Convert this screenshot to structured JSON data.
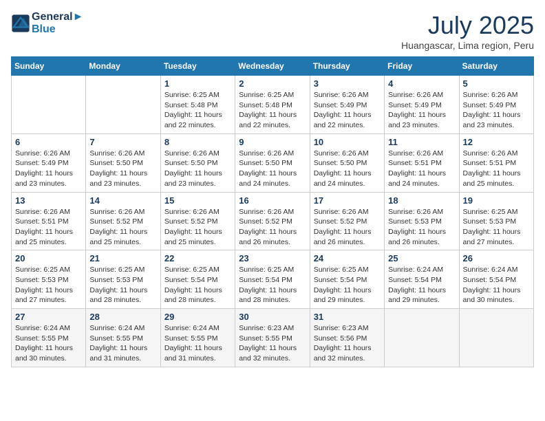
{
  "header": {
    "logo_line1": "General",
    "logo_line2": "Blue",
    "month_title": "July 2025",
    "location": "Huangascar, Lima region, Peru"
  },
  "weekdays": [
    "Sunday",
    "Monday",
    "Tuesday",
    "Wednesday",
    "Thursday",
    "Friday",
    "Saturday"
  ],
  "weeks": [
    [
      {
        "day": "",
        "info": ""
      },
      {
        "day": "",
        "info": ""
      },
      {
        "day": "1",
        "info": "Sunrise: 6:25 AM\nSunset: 5:48 PM\nDaylight: 11 hours and 22 minutes."
      },
      {
        "day": "2",
        "info": "Sunrise: 6:25 AM\nSunset: 5:48 PM\nDaylight: 11 hours and 22 minutes."
      },
      {
        "day": "3",
        "info": "Sunrise: 6:26 AM\nSunset: 5:49 PM\nDaylight: 11 hours and 22 minutes."
      },
      {
        "day": "4",
        "info": "Sunrise: 6:26 AM\nSunset: 5:49 PM\nDaylight: 11 hours and 23 minutes."
      },
      {
        "day": "5",
        "info": "Sunrise: 6:26 AM\nSunset: 5:49 PM\nDaylight: 11 hours and 23 minutes."
      }
    ],
    [
      {
        "day": "6",
        "info": "Sunrise: 6:26 AM\nSunset: 5:49 PM\nDaylight: 11 hours and 23 minutes."
      },
      {
        "day": "7",
        "info": "Sunrise: 6:26 AM\nSunset: 5:50 PM\nDaylight: 11 hours and 23 minutes."
      },
      {
        "day": "8",
        "info": "Sunrise: 6:26 AM\nSunset: 5:50 PM\nDaylight: 11 hours and 23 minutes."
      },
      {
        "day": "9",
        "info": "Sunrise: 6:26 AM\nSunset: 5:50 PM\nDaylight: 11 hours and 24 minutes."
      },
      {
        "day": "10",
        "info": "Sunrise: 6:26 AM\nSunset: 5:50 PM\nDaylight: 11 hours and 24 minutes."
      },
      {
        "day": "11",
        "info": "Sunrise: 6:26 AM\nSunset: 5:51 PM\nDaylight: 11 hours and 24 minutes."
      },
      {
        "day": "12",
        "info": "Sunrise: 6:26 AM\nSunset: 5:51 PM\nDaylight: 11 hours and 25 minutes."
      }
    ],
    [
      {
        "day": "13",
        "info": "Sunrise: 6:26 AM\nSunset: 5:51 PM\nDaylight: 11 hours and 25 minutes."
      },
      {
        "day": "14",
        "info": "Sunrise: 6:26 AM\nSunset: 5:52 PM\nDaylight: 11 hours and 25 minutes."
      },
      {
        "day": "15",
        "info": "Sunrise: 6:26 AM\nSunset: 5:52 PM\nDaylight: 11 hours and 25 minutes."
      },
      {
        "day": "16",
        "info": "Sunrise: 6:26 AM\nSunset: 5:52 PM\nDaylight: 11 hours and 26 minutes."
      },
      {
        "day": "17",
        "info": "Sunrise: 6:26 AM\nSunset: 5:52 PM\nDaylight: 11 hours and 26 minutes."
      },
      {
        "day": "18",
        "info": "Sunrise: 6:26 AM\nSunset: 5:53 PM\nDaylight: 11 hours and 26 minutes."
      },
      {
        "day": "19",
        "info": "Sunrise: 6:25 AM\nSunset: 5:53 PM\nDaylight: 11 hours and 27 minutes."
      }
    ],
    [
      {
        "day": "20",
        "info": "Sunrise: 6:25 AM\nSunset: 5:53 PM\nDaylight: 11 hours and 27 minutes."
      },
      {
        "day": "21",
        "info": "Sunrise: 6:25 AM\nSunset: 5:53 PM\nDaylight: 11 hours and 28 minutes."
      },
      {
        "day": "22",
        "info": "Sunrise: 6:25 AM\nSunset: 5:54 PM\nDaylight: 11 hours and 28 minutes."
      },
      {
        "day": "23",
        "info": "Sunrise: 6:25 AM\nSunset: 5:54 PM\nDaylight: 11 hours and 28 minutes."
      },
      {
        "day": "24",
        "info": "Sunrise: 6:25 AM\nSunset: 5:54 PM\nDaylight: 11 hours and 29 minutes."
      },
      {
        "day": "25",
        "info": "Sunrise: 6:24 AM\nSunset: 5:54 PM\nDaylight: 11 hours and 29 minutes."
      },
      {
        "day": "26",
        "info": "Sunrise: 6:24 AM\nSunset: 5:54 PM\nDaylight: 11 hours and 30 minutes."
      }
    ],
    [
      {
        "day": "27",
        "info": "Sunrise: 6:24 AM\nSunset: 5:55 PM\nDaylight: 11 hours and 30 minutes."
      },
      {
        "day": "28",
        "info": "Sunrise: 6:24 AM\nSunset: 5:55 PM\nDaylight: 11 hours and 31 minutes."
      },
      {
        "day": "29",
        "info": "Sunrise: 6:24 AM\nSunset: 5:55 PM\nDaylight: 11 hours and 31 minutes."
      },
      {
        "day": "30",
        "info": "Sunrise: 6:23 AM\nSunset: 5:55 PM\nDaylight: 11 hours and 32 minutes."
      },
      {
        "day": "31",
        "info": "Sunrise: 6:23 AM\nSunset: 5:56 PM\nDaylight: 11 hours and 32 minutes."
      },
      {
        "day": "",
        "info": ""
      },
      {
        "day": "",
        "info": ""
      }
    ]
  ]
}
